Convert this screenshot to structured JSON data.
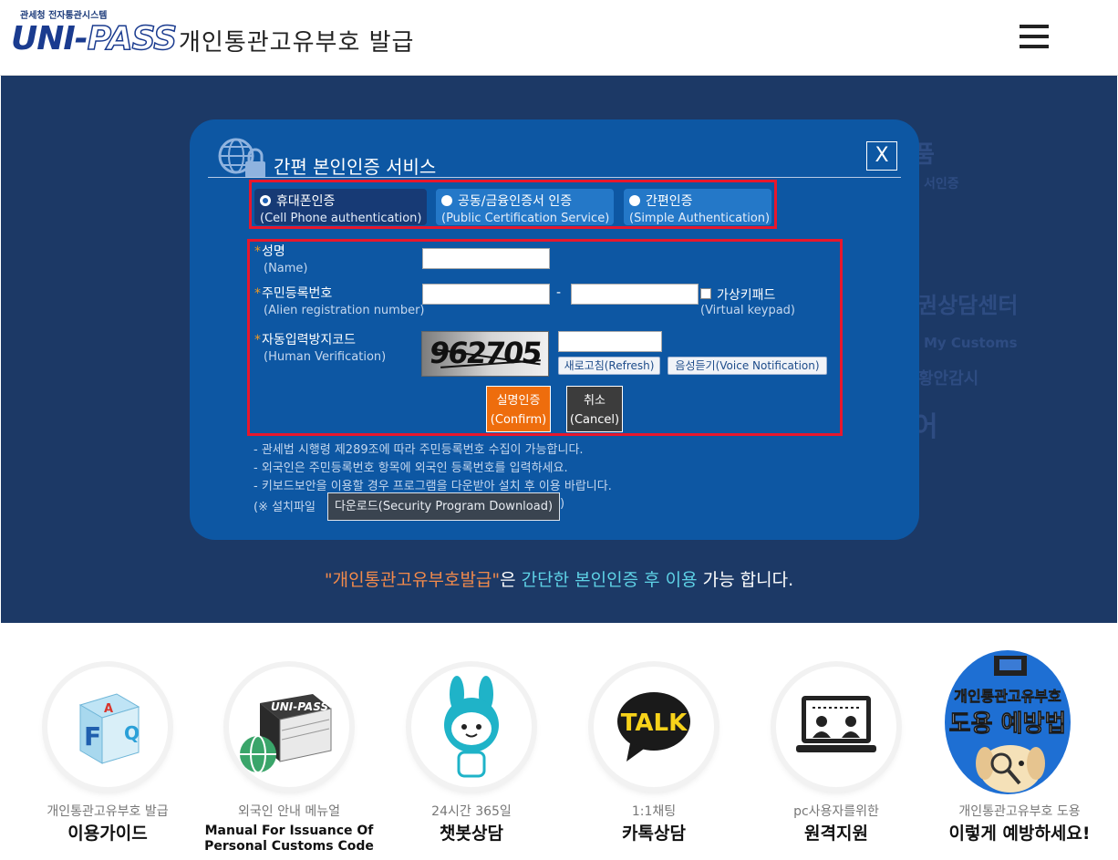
{
  "header": {
    "logo_top": "관세청 전자통관시스템",
    "logo_main_a": "UNI-",
    "logo_main_b": "PASS",
    "title": "개인통관고유부호 발급"
  },
  "background_words": [
    "품",
    "서인증",
    "권상담센터",
    "My Customs",
    "황안감시",
    "어"
  ],
  "modal": {
    "title": "간편 본인인증 서비스",
    "close_label": "X",
    "auth_options": [
      {
        "label": "휴대폰인증",
        "sub": "(Cell Phone authentication)",
        "selected": true
      },
      {
        "label": "공동/금융인증서 인증",
        "sub": "(Public Certification Service)",
        "selected": false
      },
      {
        "label": "간편인증",
        "sub": "(Simple Authentication)",
        "selected": false
      }
    ],
    "fields": {
      "name_label": "성명",
      "name_sub": "(Name)",
      "rrn_label": "주민등록번호",
      "rrn_sub": "(Alien registration number)",
      "dash": "-",
      "virtual_keypad_label": "가상키패드",
      "virtual_keypad_sub": "(Virtual keypad)",
      "captcha_label": "자동입력방지코드",
      "captcha_sub": "(Human Verification)",
      "captcha_text": "962705",
      "star": "*"
    },
    "buttons": {
      "refresh": "새로고침(Refresh)",
      "voice": "음성듣기(Voice Notification)",
      "confirm_l1": "실명인증",
      "confirm_l2": "(Confirm)",
      "cancel_l1": "취소",
      "cancel_l2": "(Cancel)"
    },
    "notes": [
      "- 관세법 시행령 제289조에 따라 주민등록번호 수집이 가능합니다.",
      "- 외국인은 주민등록번호 항목에 외국인 등록번호를 입력하세요.",
      "- 키보드보안을 이용할 경우 프로그램을 다운받아 설치 후 이용 바랍니다."
    ],
    "install_prefix": "(※ 설치파일",
    "download_label": "다운로드(Security Program Download)",
    "install_suffix": ")"
  },
  "tagline": {
    "part1": "\"개인통관고유부호발급\"",
    "part2": "은 ",
    "part3": "간단한 본인인증 후 이용",
    "part4": " 가능 합니다."
  },
  "tiles": [
    {
      "small": "개인통관고유부호 발급",
      "big": "이용가이드",
      "icon": "faq-cube-icon"
    },
    {
      "small": "외국인 안내 메뉴얼",
      "big": "Manual For Issuance Of Personal Customs Code",
      "icon": "manual-books-icon",
      "logo_text": "UNI-PASS"
    },
    {
      "small": "24시간 365일",
      "big": "챗봇상담",
      "icon": "chatbot-rabbit-icon"
    },
    {
      "small": "1:1채팅",
      "big": "카톡상담",
      "icon": "kakaotalk-icon",
      "icon_text": "TALK"
    },
    {
      "small": "pc사용자를위한",
      "big": "원격지원",
      "icon": "remote-support-icon"
    },
    {
      "small": "개인통관고유부호 도용",
      "big": "이렇게 예방하세요!",
      "icon": "theft-prevention-icon",
      "icon_text1": "개인통관고유부호",
      "icon_text2": "도용 예방법"
    }
  ],
  "colors": {
    "band": "#1c3966",
    "modal": "#0d57a3",
    "confirm": "#ee6d0d",
    "highlight_red": "#e8172c"
  }
}
